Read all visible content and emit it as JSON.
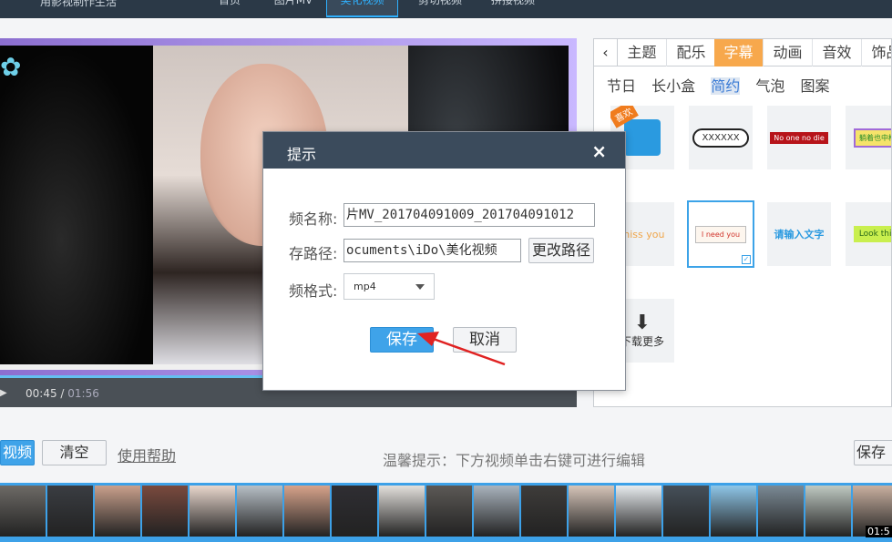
{
  "topbar": {
    "brand": "用影视制作生活",
    "tabs": [
      {
        "label": "首页",
        "active": false
      },
      {
        "label": "图片MV",
        "active": false
      },
      {
        "label": "美化视频",
        "active": true
      },
      {
        "label": "剪切视频",
        "active": false
      },
      {
        "label": "拼接视频",
        "active": false
      }
    ]
  },
  "player": {
    "current_time": "00:45",
    "separator": " / ",
    "total_time": "01:56"
  },
  "panel": {
    "tabs": [
      {
        "label": "主题",
        "active": false
      },
      {
        "label": "配乐",
        "active": false
      },
      {
        "label": "字幕",
        "active": true
      },
      {
        "label": "动画",
        "active": false
      },
      {
        "label": "音效",
        "active": false
      },
      {
        "label": "饰品",
        "active": false
      }
    ],
    "subtabs": [
      {
        "label": "节日",
        "active": false
      },
      {
        "label": "长小盒",
        "active": false
      },
      {
        "label": "简约",
        "active": true
      },
      {
        "label": "气泡",
        "active": false
      },
      {
        "label": "图案",
        "active": false
      }
    ],
    "stickers": [
      {
        "text": "喜欢"
      },
      {
        "text": "XXXXXX"
      },
      {
        "text": "No one no die"
      },
      {
        "text": "躺着也中枪"
      },
      {
        "text": "miss you"
      },
      {
        "text": "I need you",
        "selected": true
      },
      {
        "text": "请输入文字"
      },
      {
        "text": "Look this"
      }
    ],
    "download_label": "下载更多"
  },
  "toolbar": {
    "add_video": "视频",
    "clear": "清空",
    "help": "使用帮助",
    "hint": "温馨提示：下方视频单击右键可进行编辑",
    "save": "保存"
  },
  "filmstrip": {
    "time_label": "01:5",
    "thumb_colors": [
      "#6d6a66",
      "#3a3d42",
      "#c9a08c",
      "#7a4a3e",
      "#e9d7cd",
      "#b7bfc6",
      "#d7a38b",
      "#2f2e33",
      "#e3e0dc",
      "#5c5956",
      "#a9b3bd",
      "#3e3c3a",
      "#d6c5b9",
      "#e8ecef",
      "#46505a",
      "#8ec6e8",
      "#7b8a95",
      "#bfc9c2",
      "#c9b0a0",
      "#9da7b0",
      "#3b3b3b",
      "#cfd6dc",
      "#56606a",
      "#e0e4e7",
      "#2a2c2f",
      "#8a7a6e",
      "#b9c3cc",
      "#d9c7bc",
      "#5a6672",
      "#c4cdd4"
    ]
  },
  "dialog": {
    "title": "提示",
    "close_symbol": "×",
    "name_label": "频名称:",
    "name_value": "片MV_201704091009_201704091012",
    "path_label": "存路径:",
    "path_value": "ocuments\\iDo\\美化视频",
    "change_path": "更改路径",
    "format_label": "频格式:",
    "format_value": "mp4",
    "save": "保存",
    "cancel": "取消"
  },
  "colors": {
    "accent": "#3fa3e9",
    "active_tab": "#f7a84c",
    "dialog_header": "#3b4b5c",
    "annotation_arrow": "#e02222"
  }
}
